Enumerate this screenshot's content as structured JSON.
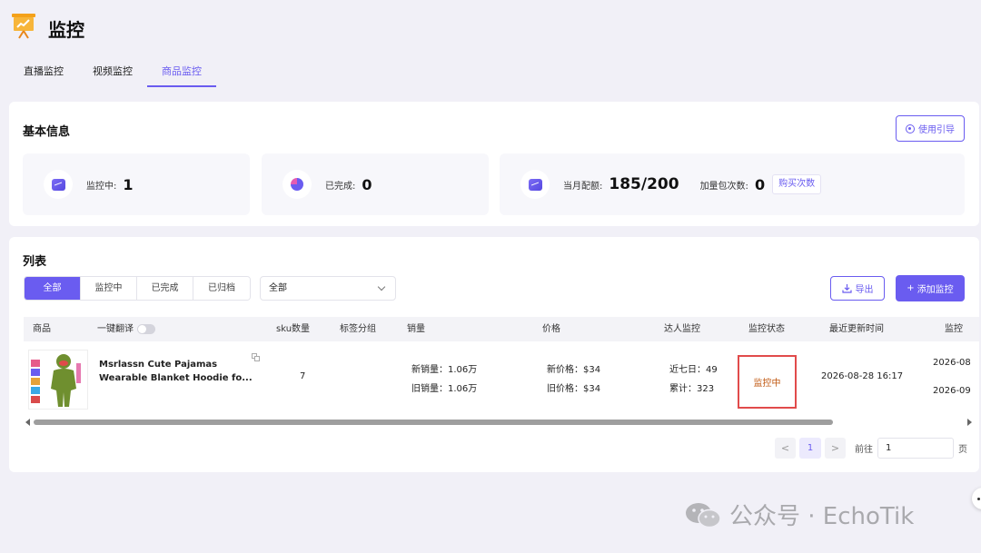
{
  "app": {
    "title": "监控"
  },
  "tabs": [
    {
      "label": "直播监控",
      "active": false
    },
    {
      "label": "视频监控",
      "active": false
    },
    {
      "label": "商品监控",
      "active": true
    }
  ],
  "basic_info": {
    "title": "基本信息",
    "guide_label": "使用引导",
    "stats": {
      "monitoring": {
        "label": "监控中:",
        "value": "1"
      },
      "completed": {
        "label": "已完成:",
        "value": "0"
      },
      "quota": {
        "label": "当月配额:",
        "value": "185/200"
      },
      "addon": {
        "label": "加量包次数:",
        "value": "0",
        "button": "购买次数"
      }
    }
  },
  "list": {
    "title": "列表",
    "filters": [
      {
        "label": "全部",
        "active": true
      },
      {
        "label": "监控中",
        "active": false
      },
      {
        "label": "已完成",
        "active": false
      },
      {
        "label": "已归档",
        "active": false
      }
    ],
    "select_value": "全部",
    "export_label": "导出",
    "add_label": "添加监控",
    "add_plus": "+",
    "columns": {
      "product": "商品",
      "translate": "一键翻译",
      "sku": "sku数量",
      "tag": "标签分组",
      "sales": "销量",
      "price": "价格",
      "influencer": "达人监控",
      "status": "监控状态",
      "updated": "最近更新时间",
      "monitor_time": "监控"
    },
    "rows": [
      {
        "name_line1": "Msrlassn Cute Pajamas",
        "name_line2": "Wearable Blanket Hoodie fo...",
        "sku": "7",
        "new_sales": "新销量：1.06万",
        "old_sales": "旧销量：1.06万",
        "new_price": "新价格：$34",
        "old_price": "旧价格：$34",
        "last7": "近七日：49",
        "total": "累计：323",
        "status": "监控中",
        "updated": "2026-08-28 16:17",
        "start_time": "2026-08",
        "end_time": "2026-09"
      }
    ]
  },
  "pagination": {
    "prev": "<",
    "current": "1",
    "next": ">",
    "goto_label": "前往",
    "goto_value": "1",
    "unit": "页"
  },
  "watermark": {
    "text": "公众号 · EchoTik"
  },
  "colors": {
    "accent": "#6a5cf0",
    "status_text": "#c0570f",
    "highlight_border": "#e14b4b",
    "background": "#f1f0f7"
  },
  "icons": [
    "logo-icon",
    "guide-icon",
    "monitor-icon",
    "pie-icon",
    "quota-icon",
    "download-icon",
    "plus-icon",
    "chevron-down-icon",
    "copy-icon",
    "wechat-icon"
  ]
}
